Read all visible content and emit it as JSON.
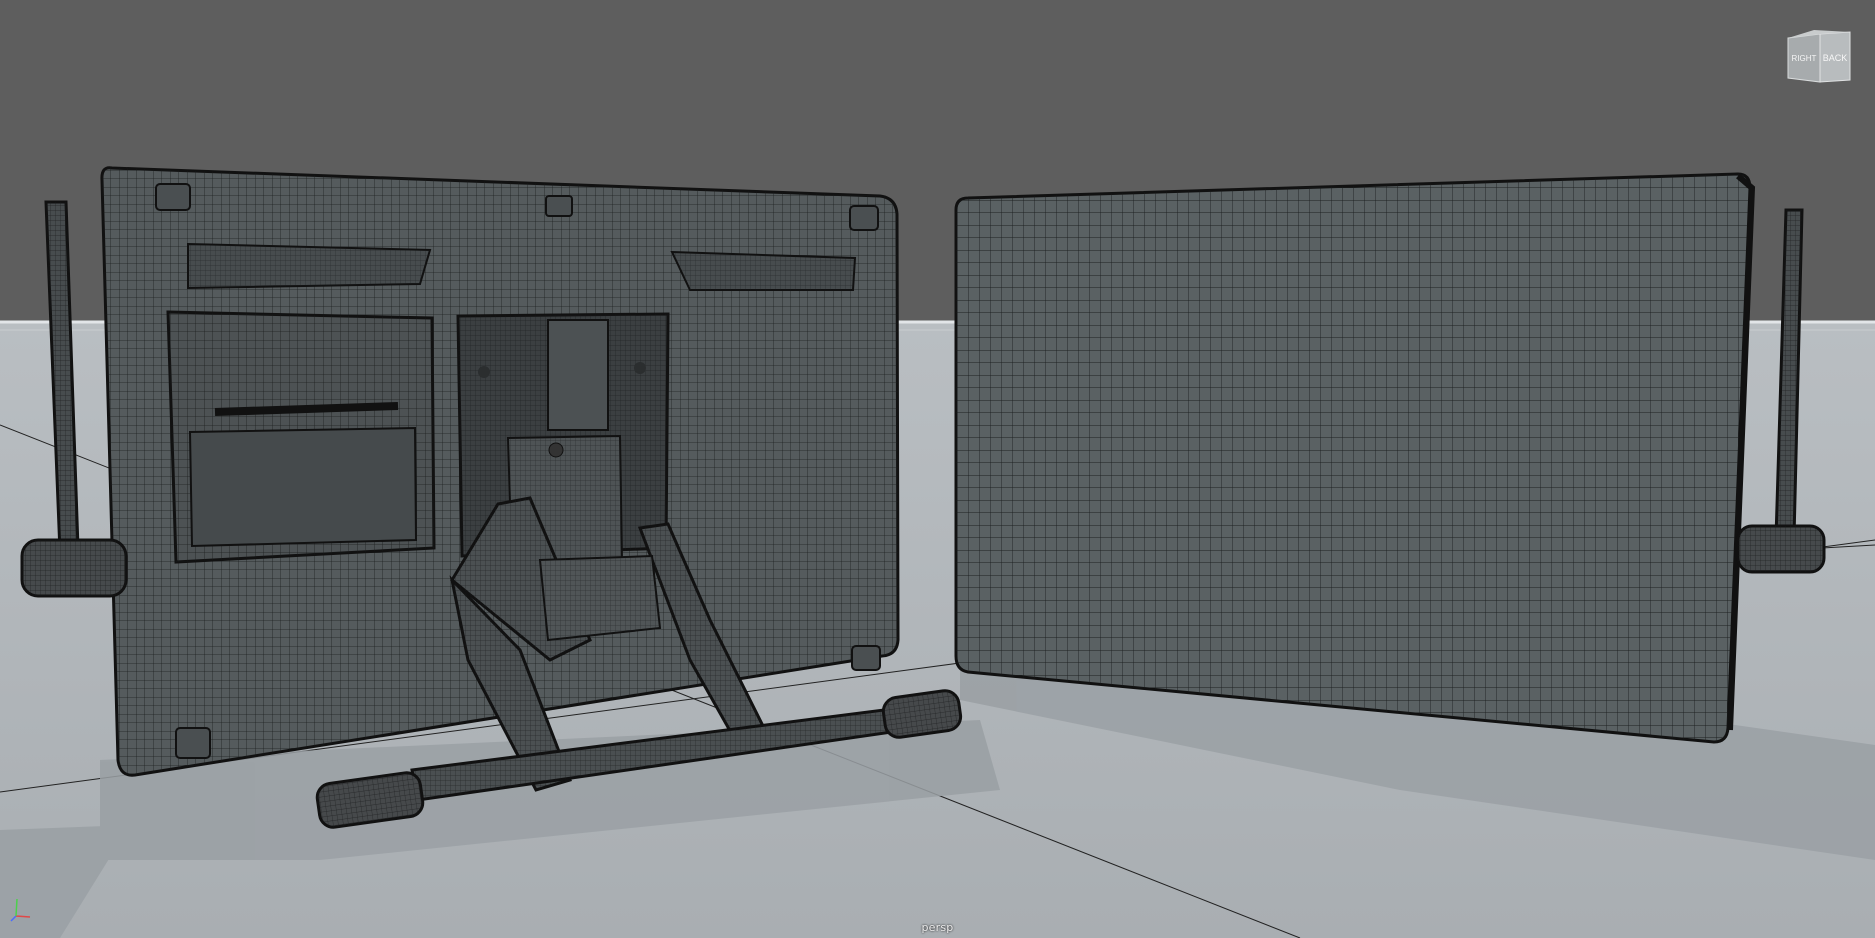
{
  "viewport": {
    "camera_label": "persp",
    "view_mode": "wireframe-on-shaded",
    "background_color": "#5e5e5e",
    "ground_color": "#b3b8bc"
  },
  "viewcube": {
    "left_face_label": "RIGHT",
    "front_face_label": "BACK"
  },
  "axis_gizmo": {
    "axes": [
      "x",
      "y",
      "z"
    ],
    "x_color": "#e04848",
    "y_color": "#4cd04c",
    "z_color": "#4a6cff"
  },
  "scene": {
    "mesh_color": "#505658",
    "wire_color": "#1a1c1d",
    "objects": [
      "tablet-back",
      "tablet-front",
      "tablet-stand",
      "left-pen",
      "right-pen"
    ]
  }
}
